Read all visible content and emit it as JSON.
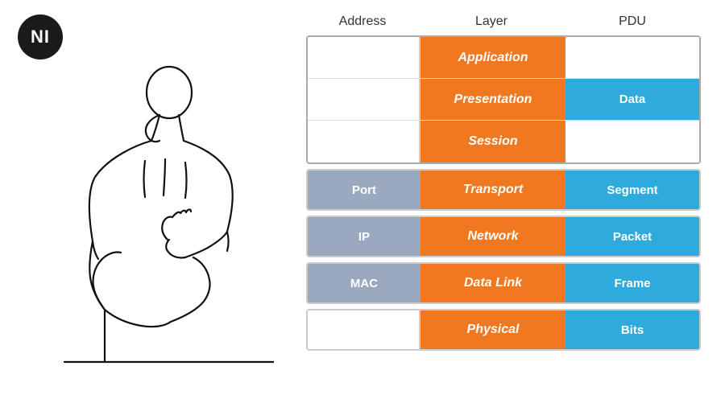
{
  "logo": {
    "text": "NI"
  },
  "headers": {
    "address": "Address",
    "layer": "Layer",
    "pdu": "PDU"
  },
  "upper_group": [
    {
      "address": "",
      "layer": "Application",
      "pdu": ""
    },
    {
      "address": "",
      "layer": "Presentation",
      "pdu": "Data"
    },
    {
      "address": "",
      "layer": "Session",
      "pdu": ""
    }
  ],
  "lower_layers": [
    {
      "address": "Port",
      "layer": "Transport",
      "pdu": "Segment"
    },
    {
      "address": "IP",
      "layer": "Network",
      "pdu": "Packet"
    },
    {
      "address": "MAC",
      "layer": "Data Link",
      "pdu": "Frame"
    },
    {
      "address": "",
      "layer": "Physical",
      "pdu": "Bits"
    }
  ],
  "colors": {
    "orange": "#f07820",
    "blue": "#2eaadc",
    "grey_address": "#9aa8c0",
    "dark": "#1a1a1a"
  }
}
